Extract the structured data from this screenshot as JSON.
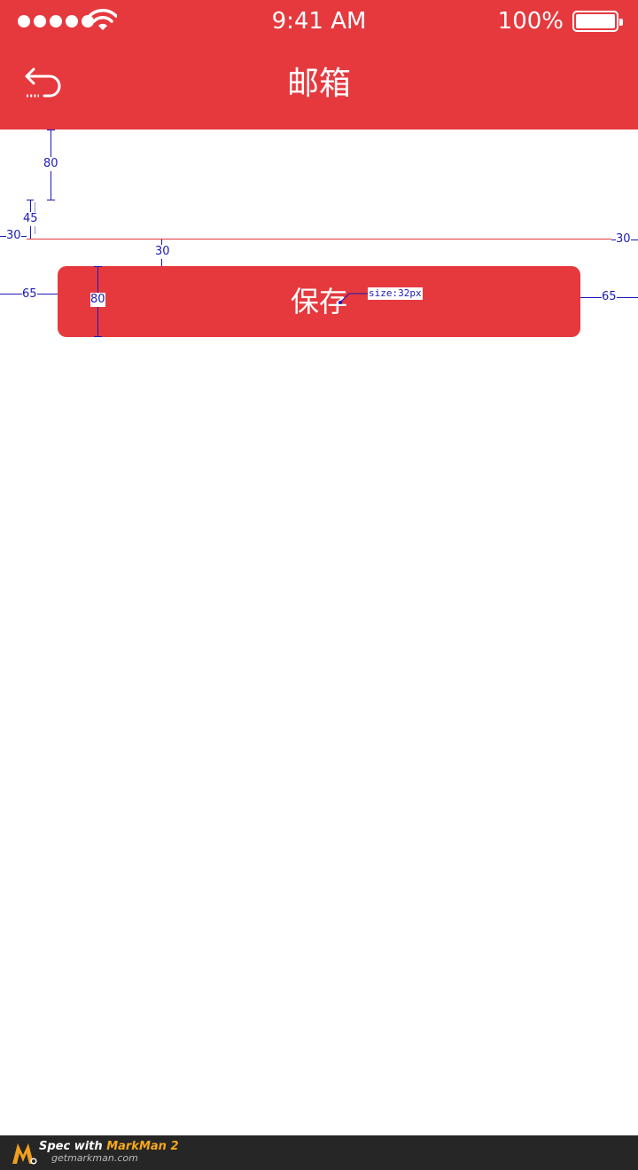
{
  "status_bar": {
    "time": "9:41 AM",
    "battery_percent": "100%",
    "signal_bars": 5,
    "icons": [
      "signal-dots-icon",
      "wifi-icon",
      "battery-icon"
    ]
  },
  "nav": {
    "title": "邮箱",
    "back_icon": "back-arrow-icon"
  },
  "form": {
    "save_label": "保存"
  },
  "annotations": {
    "m80_top": "80",
    "m45": "45",
    "m30_left": "30",
    "m30_right": "30",
    "m30_gap": "30",
    "m65_left": "65",
    "m65_right": "65",
    "m80_button": "80",
    "font_size_note": "size:32px"
  },
  "footer": {
    "prefix": "Spec with ",
    "brand": "MarkMan 2",
    "site": "getmarkman.com"
  },
  "colors": {
    "primary": "#e5393e",
    "annotation": "#1a1ab8",
    "footer_bg": "#262626",
    "footer_accent": "#f7a81b"
  }
}
